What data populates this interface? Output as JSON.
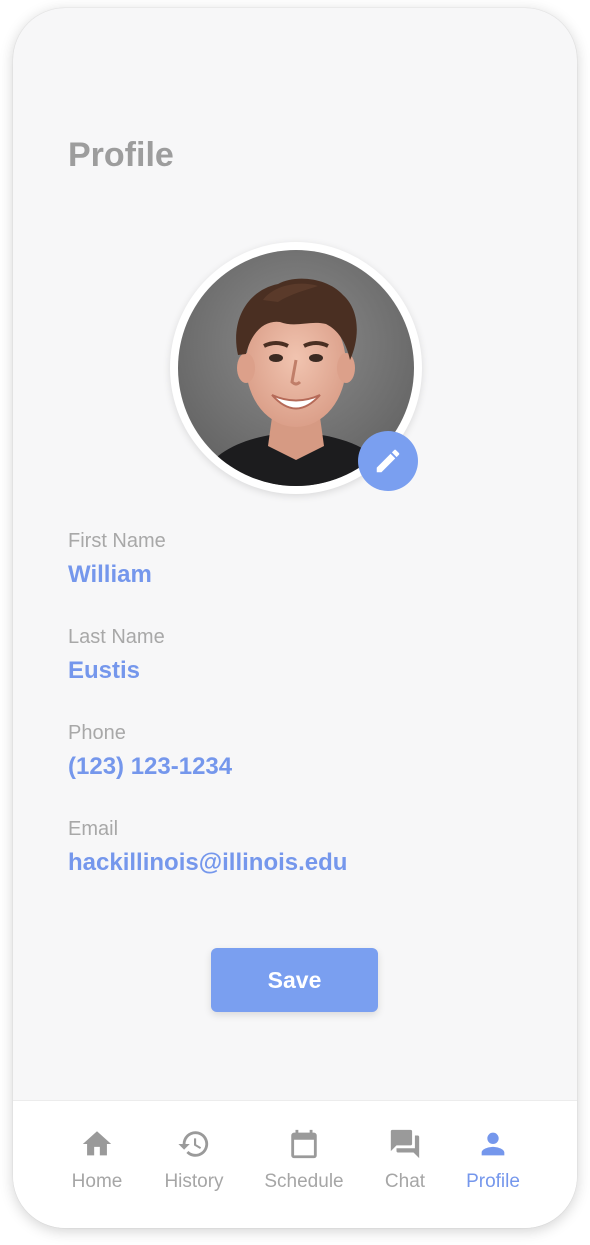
{
  "page": {
    "title": "Profile"
  },
  "profile": {
    "photo_icon": "profile-photo",
    "edit_icon": "pencil-icon",
    "fields": [
      {
        "label": "First Name",
        "value": "William"
      },
      {
        "label": "Last Name",
        "value": "Eustis"
      },
      {
        "label": "Phone",
        "value": "(123) 123-1234"
      },
      {
        "label": "Email",
        "value": "hackillinois@illinois.edu"
      }
    ]
  },
  "actions": {
    "save_label": "Save"
  },
  "tabbar": {
    "active": "Profile",
    "tabs": [
      {
        "label": "Home",
        "icon": "home-icon"
      },
      {
        "label": "History",
        "icon": "history-icon"
      },
      {
        "label": "Schedule",
        "icon": "calendar-icon"
      },
      {
        "label": "Chat",
        "icon": "chat-icon"
      },
      {
        "label": "Profile",
        "icon": "person-icon"
      }
    ]
  },
  "colors": {
    "accent": "#7597ec",
    "button": "#7a9ff0",
    "inactive": "#a6a6a6",
    "background": "#f7f7f8"
  }
}
